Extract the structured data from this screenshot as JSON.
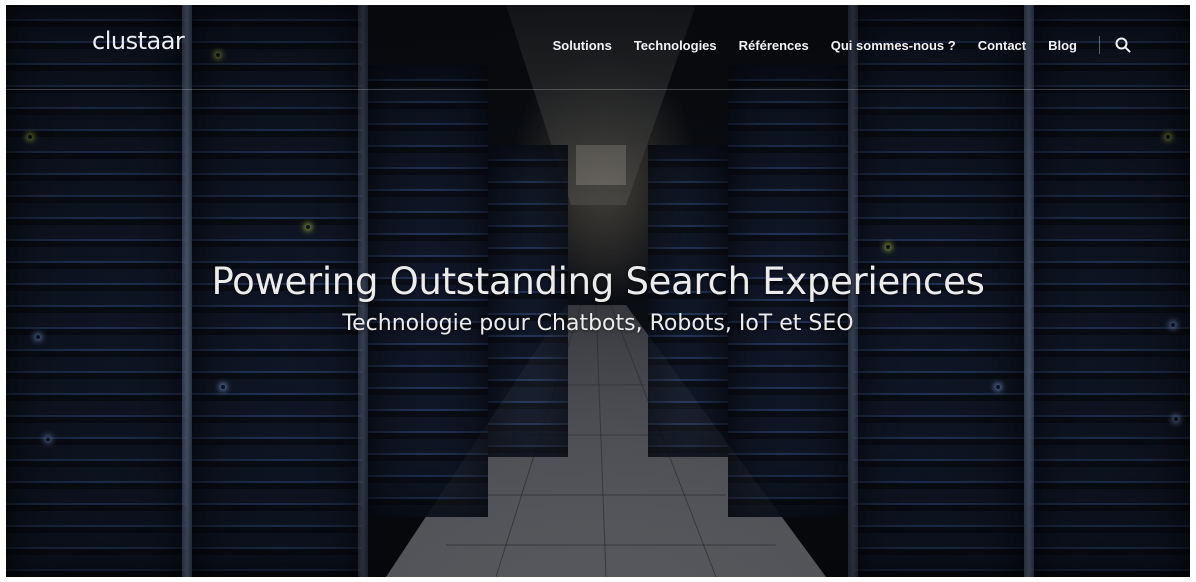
{
  "header": {
    "logo_text": "clustaar",
    "nav": [
      {
        "label": "Solutions"
      },
      {
        "label": "Technologies"
      },
      {
        "label": "Références"
      },
      {
        "label": "Qui sommes-nous ?"
      },
      {
        "label": "Contact"
      },
      {
        "label": "Blog"
      }
    ],
    "search_icon": "search-icon"
  },
  "hero": {
    "title": "Powering Outstanding Search Experiences",
    "subtitle": "Technologie pour Chatbots, Robots, IoT et SEO"
  },
  "colors": {
    "text": "#ececec",
    "background": "#0b0f1a",
    "rack_blue": "#1a2a4a",
    "led_green": "#c8d84a",
    "led_blue": "#8fb6ff"
  }
}
